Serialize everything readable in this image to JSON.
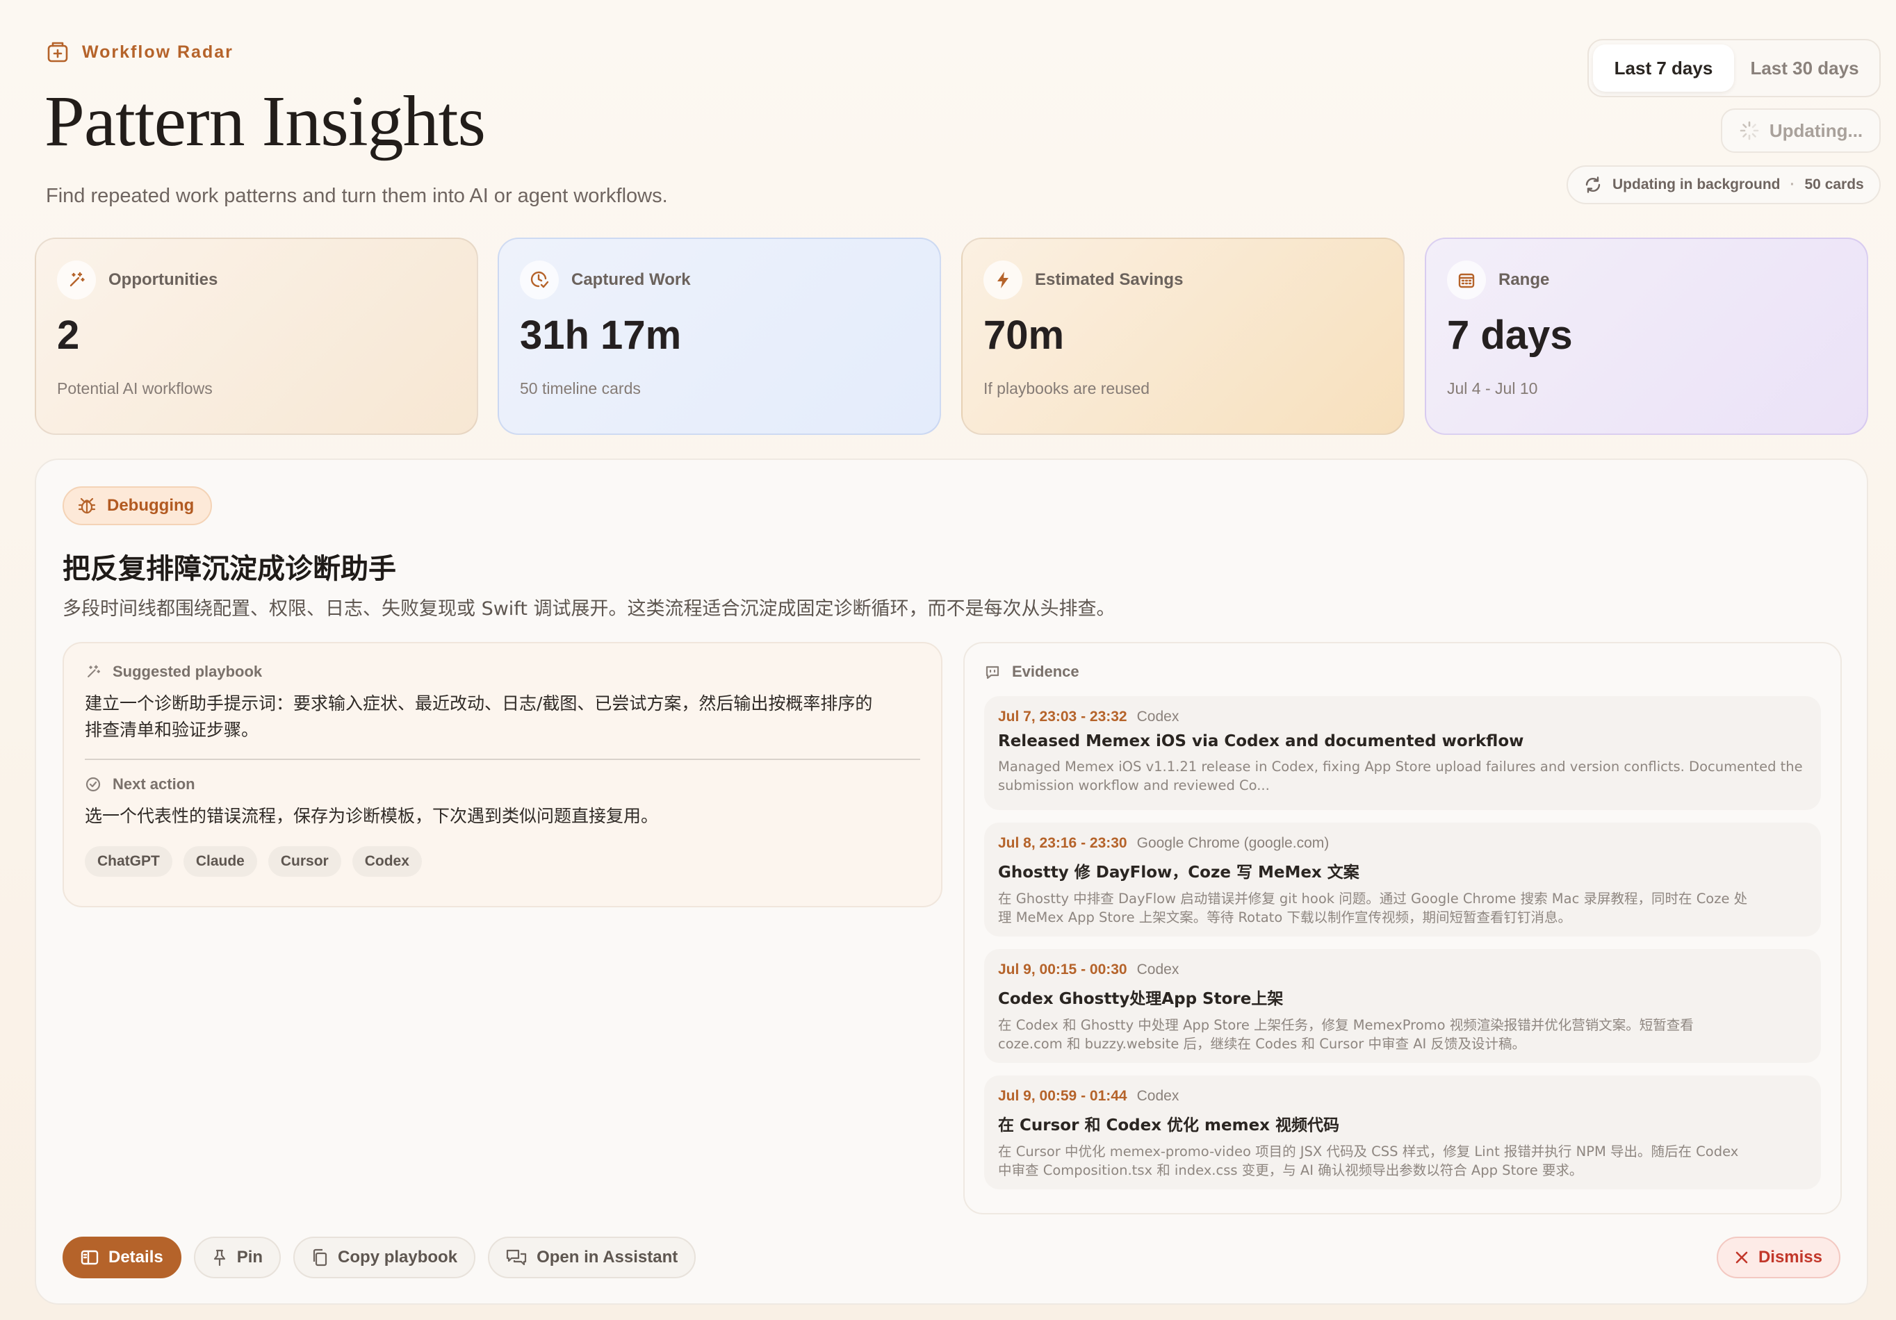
{
  "header": {
    "brand": "Workflow Radar",
    "title": "Pattern Insights",
    "subtitle": "Find repeated work patterns and turn them into AI or agent workflows.",
    "range_options": [
      "Last 7 days",
      "Last 30 days"
    ],
    "range_selected": "Last 7 days",
    "updating_button": "Updating...",
    "status_text": "Updating in background",
    "status_count": "50 cards"
  },
  "stats": [
    {
      "label": "Opportunities",
      "value": "2",
      "caption": "Potential AI workflows",
      "icon": "magic-wand-icon"
    },
    {
      "label": "Captured Work",
      "value": "31h 17m",
      "caption": "50 timeline cards",
      "icon": "clock-check-icon"
    },
    {
      "label": "Estimated Savings",
      "value": "70m",
      "caption": "If playbooks are reused",
      "icon": "lightning-icon"
    },
    {
      "label": "Range",
      "value": "7 days",
      "caption": "Jul 4 - Jul 10",
      "icon": "calendar-icon"
    }
  ],
  "insight": {
    "tag": "Debugging",
    "title": "把反复排障沉淀成诊断助手",
    "description": "多段时间线都围绕配置、权限、日志、失败复现或 Swift 调试展开。这类流程适合沉淀成固定诊断循环，而不是每次从头排查。",
    "playbook_heading": "Suggested playbook",
    "playbook_line1": "建立一个诊断助手提示词：要求输入症状、最近改动、日志/截图、已尝试方案，然后输出按概率排序的",
    "playbook_line2": "排查清单和验证步骤。",
    "next_heading": "Next action",
    "next_body": "选一个代表性的错误流程，保存为诊断模板，下次遇到类似问题直接复用。",
    "tools": [
      "ChatGPT",
      "Claude",
      "Cursor",
      "Codex"
    ],
    "evidence_heading": "Evidence",
    "evidence": [
      {
        "time": "Jul 7, 23:03 - 23:32",
        "app": "Codex",
        "title": "Released Memex iOS via Codex and documented workflow",
        "desc1": "Managed Memex iOS v1.1.21 release in Codex, fixing App Store upload failures and version conflicts. Documented the",
        "desc2": "submission workflow and reviewed Co..."
      },
      {
        "time": "Jul 8, 23:16 - 23:30",
        "app": "Google Chrome (google.com)",
        "title": "Ghostty 修 DayFlow，Coze 写 MeMex 文案",
        "desc1": "在 Ghostty 中排查 DayFlow 启动错误并修复 git hook 问题。通过 Google Chrome 搜索 Mac 录屏教程，同时在 Coze 处",
        "desc2": "理 MeMex App Store 上架文案。等待 Rotato 下载以制作宣传视频，期间短暂查看钉钉消息。"
      },
      {
        "time": "Jul 9, 00:15 - 00:30",
        "app": "Codex",
        "title": "Codex Ghostty处理App Store上架",
        "desc1": "在 Codex 和 Ghostty 中处理 App Store 上架任务，修复 MemexPromo 视频渲染报错并优化营销文案。短暂查看",
        "desc2": "coze.com 和 buzzy.website 后，继续在 Codes 和 Cursor 中审查 AI 反馈及设计稿。"
      },
      {
        "time": "Jul 9, 00:59 - 01:44",
        "app": "Codex",
        "title": "在 Cursor 和 Codex 优化 memex 视频代码",
        "desc1": "在 Cursor 中优化 memex-promo-video 项目的 JSX 代码及 CSS 样式，修复 Lint 报错并执行 NPM 导出。随后在 Codex",
        "desc2": "中审查 Composition.tsx 和 index.css 变更，与 AI 确认视频导出参数以符合 App Store 要求。"
      }
    ],
    "actions": {
      "details": "Details",
      "pin": "Pin",
      "copy": "Copy playbook",
      "assistant": "Open in Assistant",
      "dismiss": "Dismiss"
    }
  },
  "colors": {
    "accent": "#b5632a",
    "danger": "#c2372a"
  }
}
